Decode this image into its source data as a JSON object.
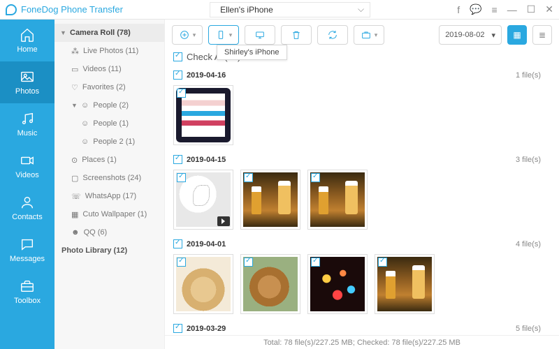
{
  "app": {
    "name": "FoneDog Phone Transfer"
  },
  "device": {
    "current": "Ellen's iPhone"
  },
  "window_controls": {
    "feedback": "f",
    "chat": "💬",
    "menu": "≡",
    "minimize": "—",
    "maximize": "☐",
    "close": "✕"
  },
  "nav": [
    {
      "label": "Home"
    },
    {
      "label": "Photos"
    },
    {
      "label": "Music"
    },
    {
      "label": "Videos"
    },
    {
      "label": "Contacts"
    },
    {
      "label": "Messages"
    },
    {
      "label": "Toolbox"
    }
  ],
  "sidebar": {
    "camera_roll": {
      "label": "Camera Roll (78)"
    },
    "items": [
      {
        "label": "Live Photos (11)"
      },
      {
        "label": "Videos (11)"
      },
      {
        "label": "Favorites (2)"
      }
    ],
    "people": {
      "label": "People (2)",
      "children": [
        {
          "label": "People (1)"
        },
        {
          "label": "People 2 (1)"
        }
      ]
    },
    "items2": [
      {
        "label": "Places (1)"
      },
      {
        "label": "Screenshots (24)"
      },
      {
        "label": "WhatsApp (17)"
      },
      {
        "label": "Cuto Wallpaper (1)"
      },
      {
        "label": "QQ (6)"
      }
    ],
    "photo_library": {
      "label": "Photo Library (12)"
    }
  },
  "toolbar": {
    "tooltip": "Shirley's iPhone",
    "date_filter": "2019-08-02"
  },
  "checkall": {
    "label": "Check All(78)"
  },
  "sections": [
    {
      "date": "2019-04-16",
      "count": "1 file(s)"
    },
    {
      "date": "2019-04-15",
      "count": "3 file(s)"
    },
    {
      "date": "2019-04-01",
      "count": "4 file(s)"
    },
    {
      "date": "2019-03-29",
      "count": "5 file(s)"
    }
  ],
  "footer": {
    "text": "Total: 78 file(s)/227.25 MB; Checked: 78 file(s)/227.25 MB"
  }
}
